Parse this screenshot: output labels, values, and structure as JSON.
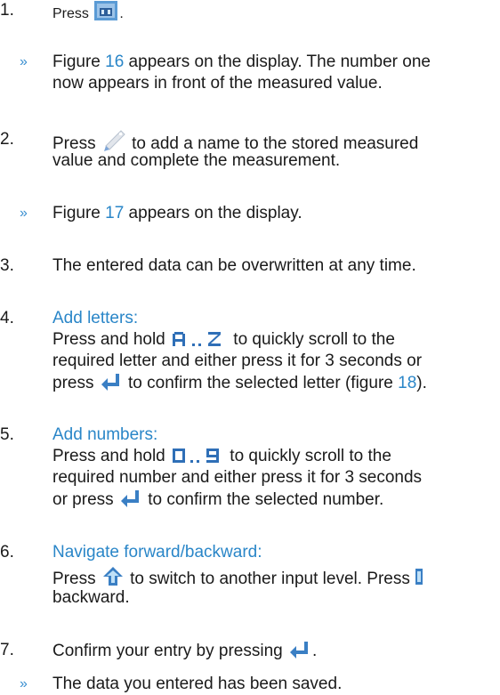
{
  "steps": {
    "s1": {
      "num": "1.",
      "pre": "Press",
      "post": "."
    },
    "r1": {
      "arrow": "»",
      "pre": "Figure ",
      "link": "16",
      "post": " appears on the display. The number one",
      "line2": "now appears in front of the measured value."
    },
    "s2": {
      "num": "2.",
      "pre": "Press",
      "post": " to add a name to the stored measured",
      "line2": "value and complete the measurement."
    },
    "r2": {
      "arrow": "»",
      "pre": "Figure ",
      "link": "17",
      "post": " appears on the display."
    },
    "s3": {
      "num": "3.",
      "text": "The entered data can be overwritten at any time."
    },
    "s4": {
      "num": "4.",
      "heading": "Add letters:",
      "l1_pre": "Press and hold",
      "l1_post": " to quickly scroll to the",
      "l2": "required letter and either press it for 3 seconds or",
      "l3_pre": "press",
      "l3_post": " to confirm the selected letter (figure ",
      "l3_link": "18",
      "l3_end": ")."
    },
    "s5": {
      "num": "5.",
      "heading": "Add numbers:",
      "l1_pre": "Press and hold",
      "l1_post": " to quickly scroll to the",
      "l2": "required number and either press it for 3 seconds",
      "l3_pre": "or press",
      "l3_post": " to confirm the selected number."
    },
    "s6": {
      "num": "6.",
      "heading": "Navigate  forward/backward:",
      "l1_pre": "Press",
      "l1_post": " to switch to another input level. Press",
      "l2": "backward."
    },
    "s7": {
      "num": "7.",
      "pre": "Confirm your entry by pressing",
      "post": "."
    },
    "r7": {
      "arrow": "»",
      "text": "The data you entered has been saved."
    }
  },
  "icons": {
    "memory": "memory-icon",
    "pencil": "pencil-icon",
    "letters": "letters-a-z-icon",
    "enter": "enter-icon",
    "numbers": "numbers-0-9-icon",
    "shift": "shift-up-icon",
    "accent": "#2a86c8"
  }
}
